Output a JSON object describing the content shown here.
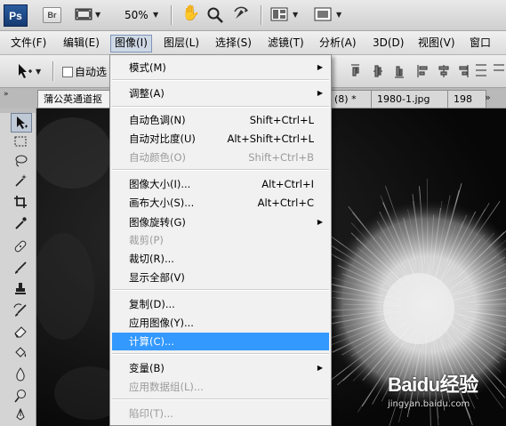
{
  "app": {
    "logo": "Ps",
    "bridge": "Br",
    "zoom": "50%"
  },
  "menubar": {
    "items": [
      {
        "label": "文件(F)"
      },
      {
        "label": "编辑(E)"
      },
      {
        "label": "图像(I)"
      },
      {
        "label": "图层(L)"
      },
      {
        "label": "选择(S)"
      },
      {
        "label": "滤镜(T)"
      },
      {
        "label": "分析(A)"
      },
      {
        "label": "3D(D)"
      },
      {
        "label": "视图(V)"
      },
      {
        "label": "窗口"
      }
    ]
  },
  "options": {
    "auto_select_label": "自动选"
  },
  "tabs": [
    {
      "label": "蒲公英通道抠"
    },
    {
      "label": "(8) *"
    },
    {
      "label": "1980-1.jpg"
    },
    {
      "label": "198"
    }
  ],
  "image_menu": {
    "items": [
      {
        "label": "模式(M)",
        "shortcut": "",
        "submenu": true,
        "disabled": false
      },
      {
        "label": "调整(A)",
        "shortcut": "",
        "submenu": true,
        "disabled": false
      },
      {
        "label": "自动色调(N)",
        "shortcut": "Shift+Ctrl+L",
        "submenu": false,
        "disabled": false
      },
      {
        "label": "自动对比度(U)",
        "shortcut": "Alt+Shift+Ctrl+L",
        "submenu": false,
        "disabled": false
      },
      {
        "label": "自动颜色(O)",
        "shortcut": "Shift+Ctrl+B",
        "submenu": false,
        "disabled": true
      },
      {
        "label": "图像大小(I)...",
        "shortcut": "Alt+Ctrl+I",
        "submenu": false,
        "disabled": false
      },
      {
        "label": "画布大小(S)...",
        "shortcut": "Alt+Ctrl+C",
        "submenu": false,
        "disabled": false
      },
      {
        "label": "图像旋转(G)",
        "shortcut": "",
        "submenu": true,
        "disabled": false
      },
      {
        "label": "裁剪(P)",
        "shortcut": "",
        "submenu": false,
        "disabled": true
      },
      {
        "label": "裁切(R)...",
        "shortcut": "",
        "submenu": false,
        "disabled": false
      },
      {
        "label": "显示全部(V)",
        "shortcut": "",
        "submenu": false,
        "disabled": false
      },
      {
        "label": "复制(D)...",
        "shortcut": "",
        "submenu": false,
        "disabled": false
      },
      {
        "label": "应用图像(Y)...",
        "shortcut": "",
        "submenu": false,
        "disabled": false
      },
      {
        "label": "计算(C)...",
        "shortcut": "",
        "submenu": false,
        "disabled": false,
        "highlighted": true
      },
      {
        "label": "变量(B)",
        "shortcut": "",
        "submenu": true,
        "disabled": false
      },
      {
        "label": "应用数据组(L)...",
        "shortcut": "",
        "submenu": false,
        "disabled": true
      },
      {
        "label": "陷印(T)...",
        "shortcut": "",
        "submenu": false,
        "disabled": true
      }
    ]
  },
  "watermark": {
    "brand": "Baidu经验",
    "url": "jingyan.baidu.com"
  },
  "colors": {
    "highlight": "#3399ff",
    "ps_logo": "#1f4c8a"
  }
}
